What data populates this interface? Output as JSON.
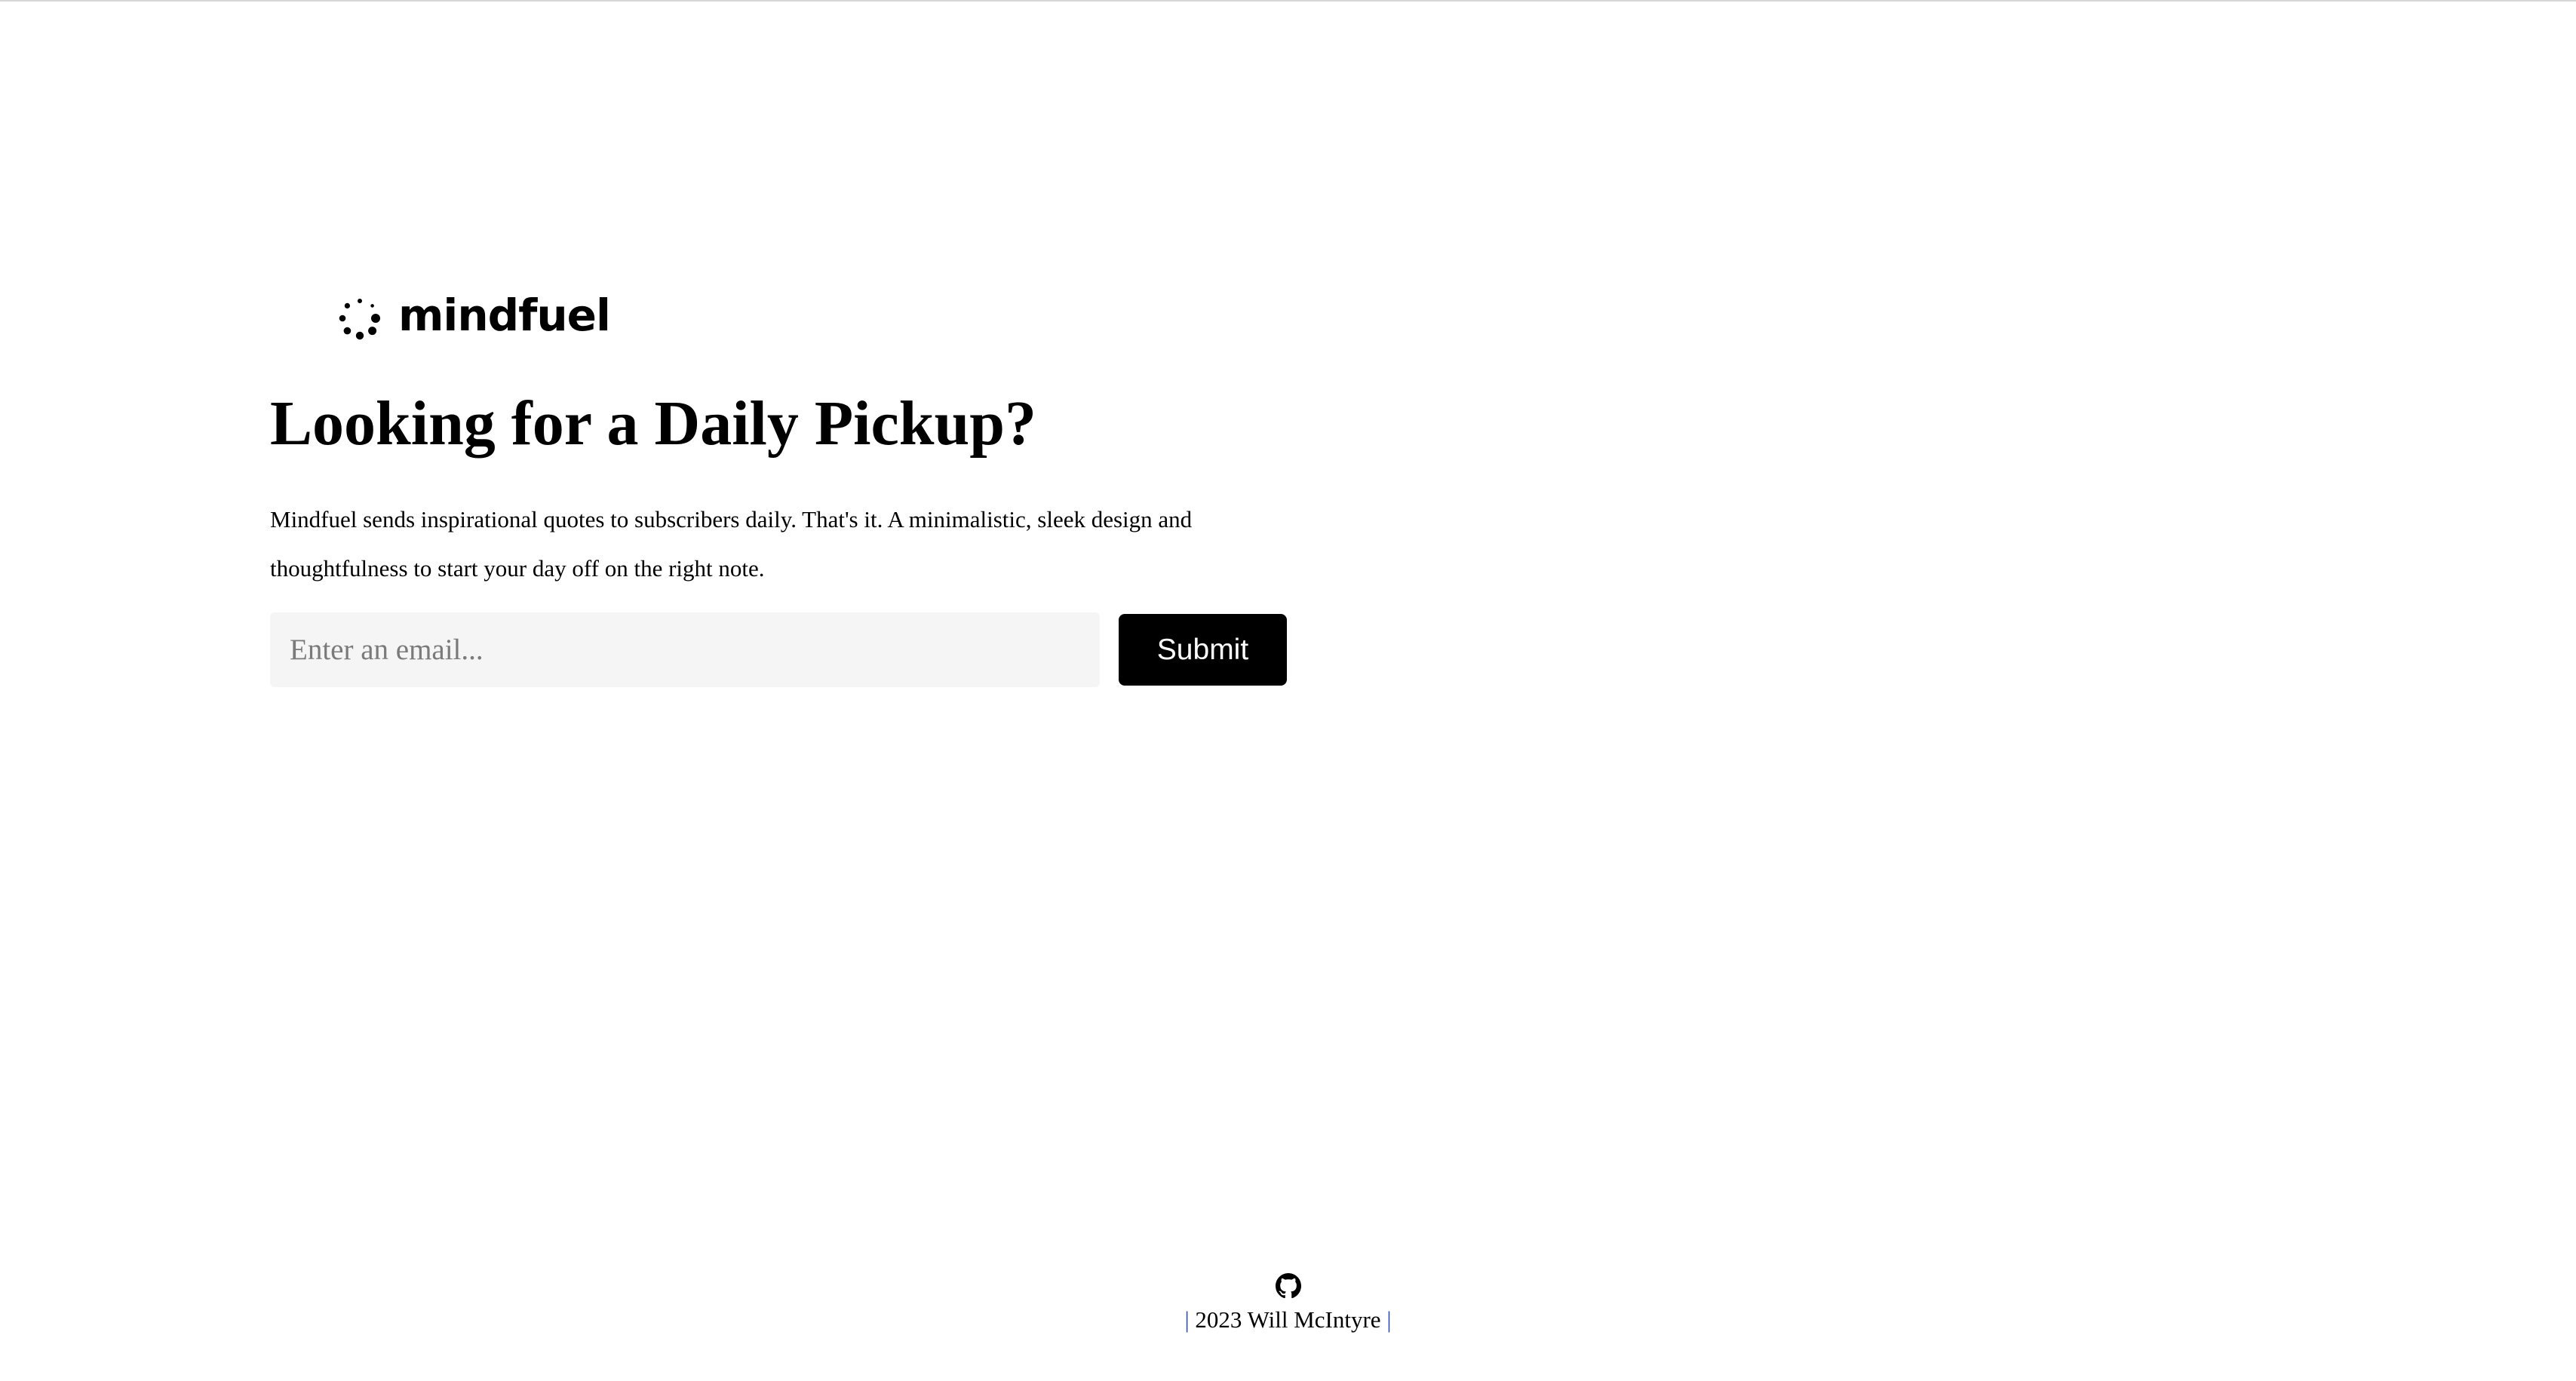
{
  "brand": {
    "name": "mindfuel",
    "logo_icon": "dotted-circle-icon"
  },
  "hero": {
    "headline": "Looking for a Daily Pickup?",
    "description": "Mindfuel sends inspirational quotes to subscribers daily. That's it. A minimalistic, sleek design and thoughtfulness to start your day off on the right note."
  },
  "signup": {
    "email_placeholder": "Enter an email...",
    "email_value": "",
    "submit_label": "Submit"
  },
  "footer": {
    "icon": "github-icon",
    "separator": "|",
    "credit": "2023 Will McIntyre"
  },
  "colors": {
    "background": "#ffffff",
    "text": "#000000",
    "button_bg": "#000000",
    "button_text": "#ffffff",
    "input_bg": "#f5f5f5",
    "separator": "#2b4bb3"
  }
}
